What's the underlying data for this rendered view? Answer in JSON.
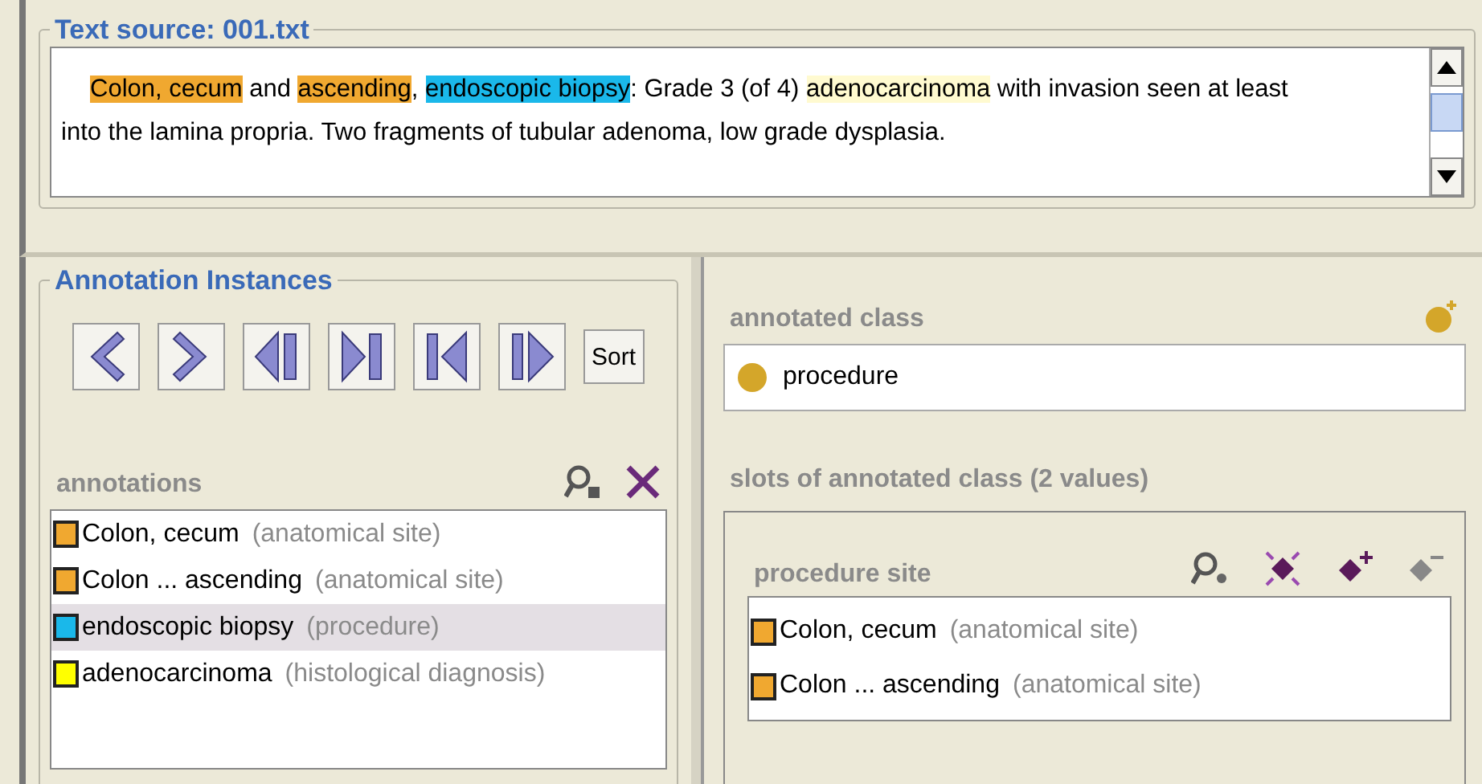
{
  "text_source": {
    "title": "Text source: 001.txt",
    "segments": [
      {
        "text": "Colon, cecum",
        "color": "#f0a830"
      },
      {
        "text": " and "
      },
      {
        "text": "ascending",
        "color": "#f0a830"
      },
      {
        "text": ", "
      },
      {
        "text": "endoscopic biopsy",
        "color": "#1ab8ea"
      },
      {
        "text": ":  Grade 3 (of 4) "
      },
      {
        "text": "adenocarcinoma",
        "color": "#fffad0"
      },
      {
        "text": " with invasion seen at least into the lamina propria.  Two fragments of tubular adenoma, low grade dysplasia."
      }
    ]
  },
  "instances": {
    "title": "Annotation Instances",
    "nav_buttons": [
      {
        "kind": "previous"
      },
      {
        "kind": "next"
      },
      {
        "kind": "previous-span"
      },
      {
        "kind": "next-span"
      },
      {
        "kind": "first"
      },
      {
        "kind": "last"
      }
    ],
    "sort_button": "Sort",
    "annotations_label": "annotations",
    "annotations": [
      {
        "text": "Colon, cecum",
        "class": "(anatomical site)",
        "color": "#f0a830",
        "selected": false
      },
      {
        "text": "Colon ... ascending",
        "class": "(anatomical site)",
        "color": "#f0a830",
        "selected": false
      },
      {
        "text": "endoscopic biopsy",
        "class": "(procedure)",
        "color": "#1ab8ea",
        "selected": true
      },
      {
        "text": "adenocarcinoma",
        "class": "(histological diagnosis)",
        "color": "#ffff00",
        "selected": false
      }
    ]
  },
  "detail": {
    "annotated_class_label": "annotated class",
    "annotated_class": "procedure",
    "slots_label": "slots of annotated class (2 values)",
    "slot": {
      "name": "procedure site",
      "values": [
        {
          "text": "Colon, cecum",
          "class": "(anatomical site)",
          "color": "#f0a830"
        },
        {
          "text": "Colon ... ascending",
          "class": "(anatomical site)",
          "color": "#f0a830"
        }
      ]
    }
  }
}
